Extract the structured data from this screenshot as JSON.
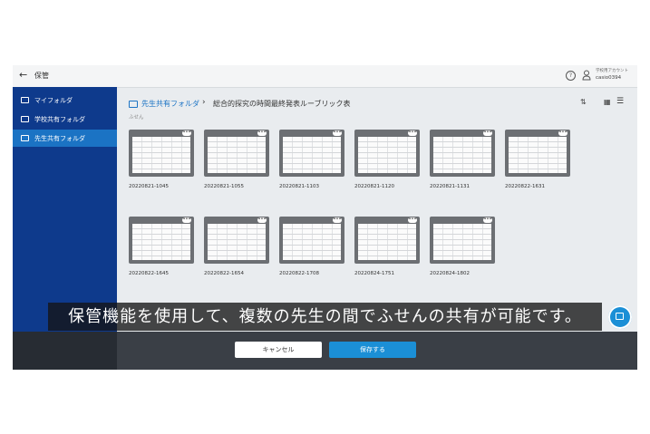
{
  "topbar": {
    "back_icon": "←",
    "title": "保管",
    "help_icon": "?",
    "account_label": "学校用アカウント",
    "account_id": "casio0394"
  },
  "sidebar": {
    "items": [
      {
        "label": "マイフォルダ",
        "active": false
      },
      {
        "label": "学校共有フォルダ",
        "active": false
      },
      {
        "label": "先生共有フォルダ",
        "active": true
      }
    ]
  },
  "content": {
    "breadcrumb_parent": "先生共有フォルダ",
    "breadcrumb_separator": "›",
    "breadcrumb_current": "総合的探究の時間最終発表ルーブリック表",
    "sub_label": "ふせん",
    "sort_icon": "⇅",
    "grid_icon": "▦",
    "list_icon": "☰",
    "more_icon": "•••",
    "files": [
      "20220821-1045",
      "20220821-1055",
      "20220821-1103",
      "20220821-1120",
      "20220821-1131",
      "20220822-1631",
      "20220822-1645",
      "20220822-1654",
      "20220822-1708",
      "20220824-1751",
      "20220824-1802"
    ]
  },
  "caption": "保管機能を使用して、複数の先生の間でふせんの共有が可能です。",
  "footer": {
    "cancel_label": "キャンセル",
    "save_label": "保存する"
  },
  "colors": {
    "sidebar": "#0e3a8c",
    "sidebar_active": "#1b73c4",
    "accent": "#1b8fd6"
  }
}
